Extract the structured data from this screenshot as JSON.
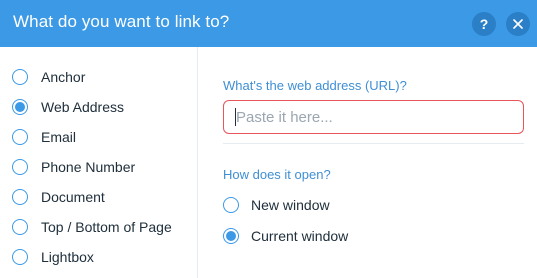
{
  "header": {
    "title": "What do you want to link to?",
    "help_label": "?",
    "close_icon": "close-icon"
  },
  "sidebar": {
    "items": [
      {
        "label": "Anchor",
        "selected": false
      },
      {
        "label": "Web Address",
        "selected": true
      },
      {
        "label": "Email",
        "selected": false
      },
      {
        "label": "Phone Number",
        "selected": false
      },
      {
        "label": "Document",
        "selected": false
      },
      {
        "label": "Top / Bottom of Page",
        "selected": false
      },
      {
        "label": "Lightbox",
        "selected": false
      }
    ]
  },
  "main": {
    "url_question": "What's the web address (URL)?",
    "url_input": {
      "value": "",
      "placeholder": "Paste it here..."
    },
    "open_question": "How does it open?",
    "open_options": [
      {
        "label": "New window",
        "selected": false
      },
      {
        "label": "Current window",
        "selected": true
      }
    ]
  },
  "colors": {
    "header_bg": "#3b99e6",
    "accent": "#3b99e6",
    "error_border": "#e8555a"
  }
}
